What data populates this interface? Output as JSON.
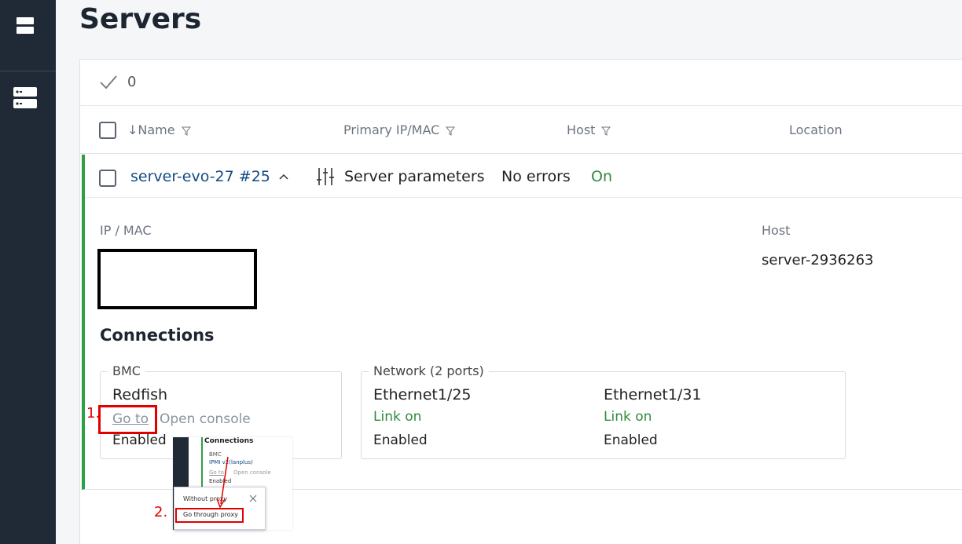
{
  "page": {
    "title": "Servers"
  },
  "selection": {
    "count": "0"
  },
  "table": {
    "columns": [
      {
        "label": "↓Name",
        "filter": true
      },
      {
        "label": "Primary IP/MAC",
        "filter": true
      },
      {
        "label": "Host",
        "filter": true
      },
      {
        "label": "Location",
        "filter": false
      }
    ]
  },
  "server": {
    "name": "server-evo-27 #25",
    "params_label": "Server parameters",
    "errors": "No errors",
    "power": "On",
    "ip_label": "IP / MAC",
    "host_label": "Host",
    "host_value": "server-2936263",
    "connections_title": "Connections",
    "bmc": {
      "legend": "BMC",
      "protocol": "Redfish",
      "goto": "Go to",
      "open_console": "Open console",
      "status": "Enabled"
    },
    "network": {
      "legend": "Network (2 ports)",
      "ports": [
        {
          "name": "Ethernet1/25",
          "link": "Link on",
          "status": "Enabled"
        },
        {
          "name": "Ethernet1/31",
          "link": "Link on",
          "status": "Enabled"
        }
      ]
    }
  },
  "annotations": {
    "step1": "1.",
    "step2": "2.",
    "inset": {
      "connections": "Connections",
      "bmc": "BMC",
      "protocol": "IPMI v2(lanplus)",
      "goto": "Go to",
      "open_console": "Open console",
      "enabled": "Enabled",
      "without_proxy": "Without proxy",
      "through_proxy": "Go through proxy"
    }
  },
  "colors": {
    "sidebar": "#1f2a36",
    "accent_green": "#2e9e48",
    "link_blue": "#124b82",
    "annotation_red": "#e00000"
  },
  "icons": [
    "menu-icon",
    "servers-icon",
    "checkmark-icon",
    "filter-icon",
    "chevron-up-icon",
    "sliders-icon",
    "close-icon"
  ]
}
